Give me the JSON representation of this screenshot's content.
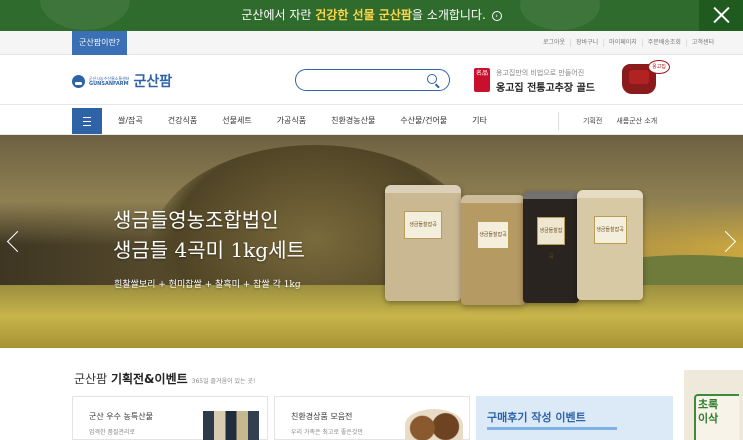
{
  "promo": {
    "prefix": "군산에서 자란 ",
    "highlight": "건강한 선물 군산팜",
    "suffix": "을 소개합니다.",
    "arrow": "›"
  },
  "util": {
    "who_label": "군산팜이란?",
    "links": [
      "로그아웃",
      "장바구니",
      "마이페이지",
      "주문배송조회",
      "고객센터"
    ]
  },
  "header": {
    "logo_line1": "군산시농수산물소통센터",
    "logo_line2": "GUNSANFARM",
    "logo_big": "군산팜",
    "search_placeholder": "",
    "ad_seal": "名品",
    "ad_line1": "옹고집만의 비법으로 만들어진",
    "ad_line2": "옹고집 전통고추장 골드",
    "ad_lid": "옹고집"
  },
  "nav": {
    "items": [
      "쌀/잡곡",
      "건강식품",
      "선물세트",
      "가공식품",
      "친환경농산물",
      "수산물/건어물",
      "기타"
    ],
    "right": [
      "기획전",
      "새롬군산 소개"
    ]
  },
  "hero": {
    "title_line1": "생금들영농조합법인",
    "title_line2": "생금들 4곡미 1kg세트",
    "subtitle": "흰찰쌀보리 + 현미찹쌀 + 찰흑미 + 찹쌀 각 1kg",
    "bag_label": "생금들찰잡곡"
  },
  "section": {
    "title_a": "군산팜 ",
    "title_b": "기획전&이벤트",
    "title_c": "365일 즐거움이 있는 곳!",
    "cards": [
      {
        "title": "군산 우수 농특산물",
        "desc": "엄격한 품질관리로"
      },
      {
        "title": "친환경상품 모음전",
        "desc": "우리 가족은 최고로 좋은것만"
      },
      {
        "title": "구매후기 작성 이벤트",
        "desc": ""
      }
    ],
    "side_ad": "초록이삭"
  },
  "colors": {
    "promo_bg": "#2f6b2c",
    "brand_blue": "#2e63a8",
    "highlight": "#ffd54a"
  }
}
